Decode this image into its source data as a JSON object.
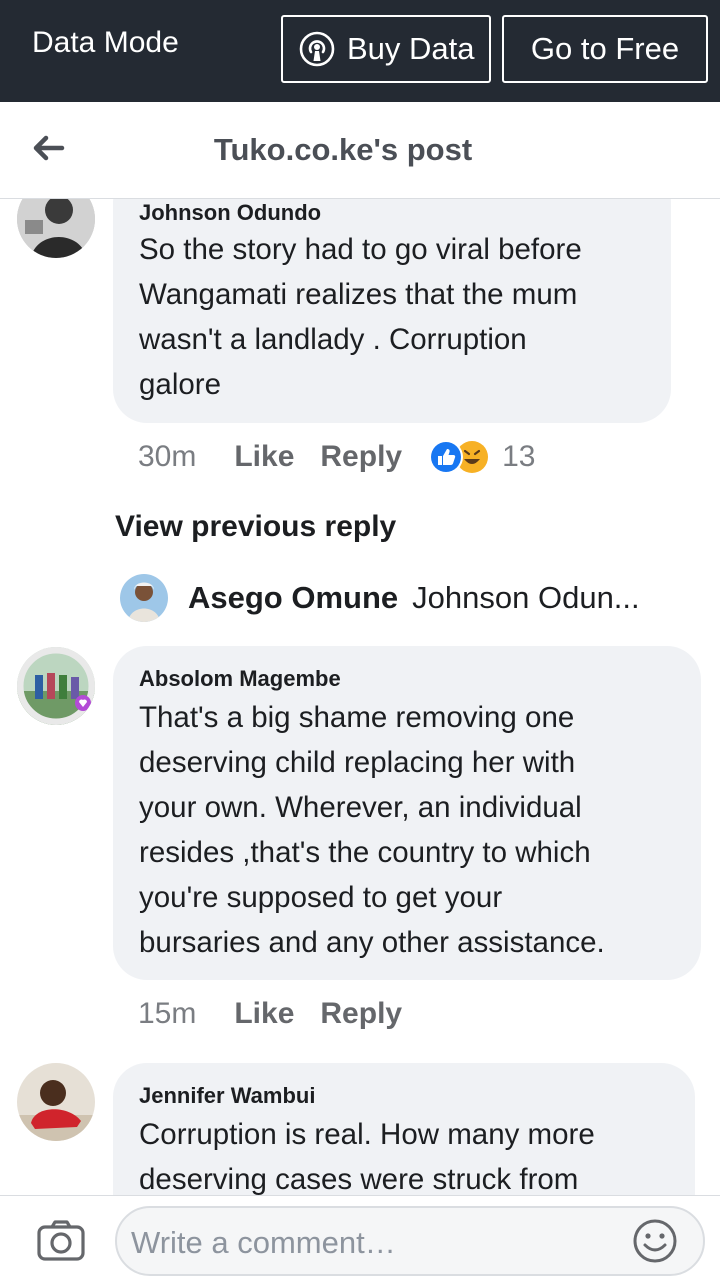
{
  "data_bar": {
    "mode_label": "Data Mode",
    "buy_label": "Buy Data",
    "free_label": "Go to Free"
  },
  "header": {
    "title": "Tuko.co.ke's post"
  },
  "comments": [
    {
      "name": "Johnson Odundo",
      "text": "So the story had to go viral before\nWangamati realizes that the mum\nwasn't a landlady . Corruption\ngalore",
      "time": "30m",
      "like": "Like",
      "reply": "Reply",
      "reactions": [
        "like",
        "haha"
      ],
      "reaction_count": "13"
    },
    {
      "name": "Absolom Magembe",
      "text": "That's a big shame removing one\ndeserving child replacing her with\nyour own. Wherever, an individual\nresides ,that's the country to which\nyou're supposed to get your\nbursaries and any other assistance.",
      "time": "15m",
      "like": "Like",
      "reply": "Reply"
    },
    {
      "name": "Jennifer Wambui",
      "text": "Corruption is real.  How many more\ndeserving cases were struck from"
    }
  ],
  "view_previous": "View previous reply",
  "reply_preview": {
    "name": "Asego Omune",
    "text": "Johnson Odun..."
  },
  "composer": {
    "placeholder": "Write a comment…"
  },
  "colors": {
    "data_bar_bg": "#242a33",
    "bubble_bg": "#f0f2f5",
    "like_blue": "#1877f2",
    "haha_yellow": "#f7b125"
  }
}
